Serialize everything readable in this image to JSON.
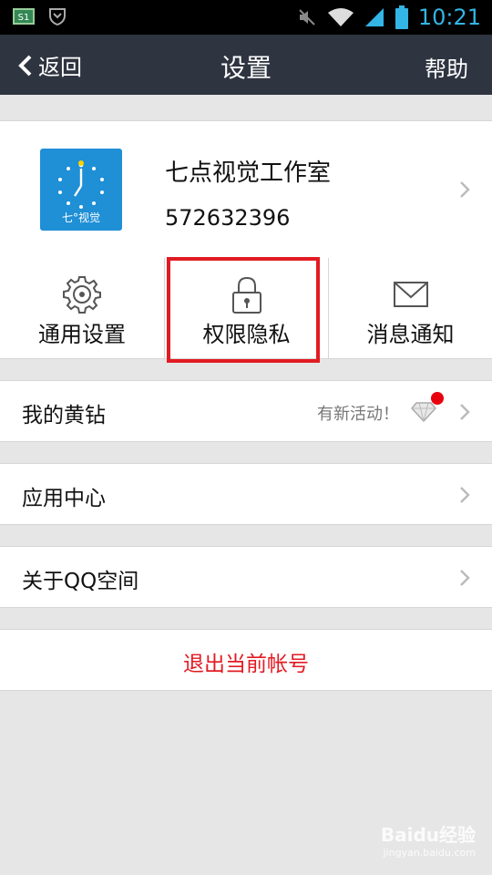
{
  "status_bar": {
    "time": "10:21",
    "badge": "S1"
  },
  "nav": {
    "back_label": "返回",
    "title": "设置",
    "help_label": "帮助"
  },
  "profile": {
    "name": "七点视觉工作室",
    "qq_number": "572632396",
    "avatar_text": "七°视觉"
  },
  "tiles": [
    {
      "label": "通用设置",
      "icon": "gear-icon"
    },
    {
      "label": "权限隐私",
      "icon": "lock-icon"
    },
    {
      "label": "消息通知",
      "icon": "envelope-icon"
    }
  ],
  "menu": {
    "vip": {
      "label": "我的黄钻",
      "promo": "有新活动！"
    },
    "app_center": {
      "label": "应用中心"
    },
    "about": {
      "label": "关于QQ空间"
    }
  },
  "logout": {
    "label": "退出当前帐号"
  },
  "watermark": {
    "brand": "Baidu经验",
    "url": "jingyan.baidu.com"
  },
  "colors": {
    "accent_red": "#e21b22",
    "nav_bg": "#2e3440",
    "status_time": "#33b5e5",
    "avatar_bg": "#1f8fd6"
  }
}
